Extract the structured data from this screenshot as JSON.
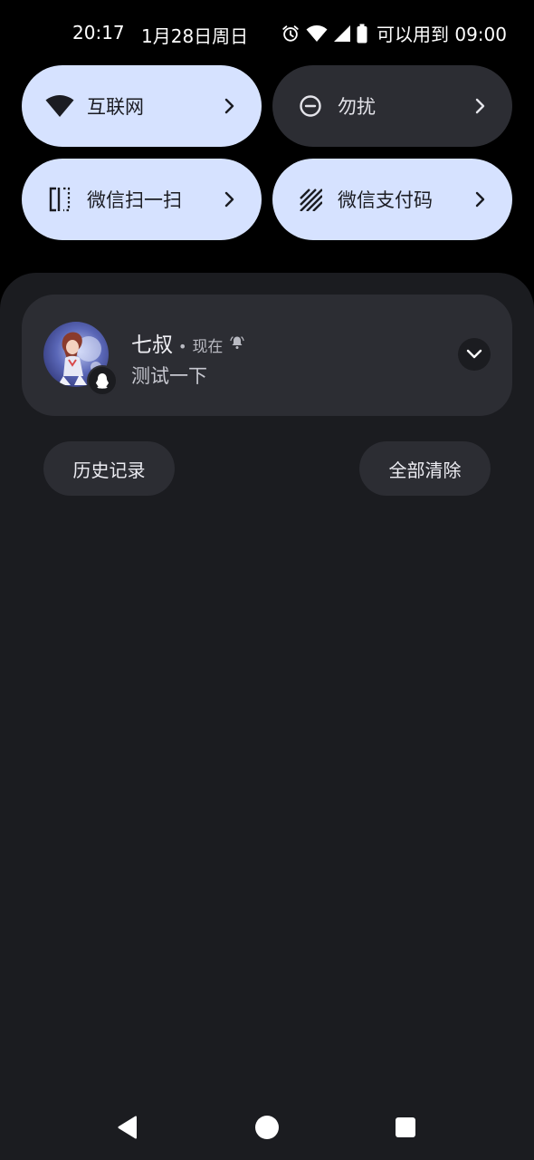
{
  "status_bar": {
    "time": "20:17",
    "date": "1月28日周日",
    "alarm_text": "可以用到 09:00",
    "icons": [
      "alarm-icon",
      "wifi-icon",
      "signal-icon",
      "battery-icon"
    ]
  },
  "quick_tiles": [
    {
      "label": "互联网",
      "icon": "wifi-icon",
      "state": "on"
    },
    {
      "label": "勿扰",
      "icon": "do-not-disturb-icon",
      "state": "off"
    },
    {
      "label": "微信扫一扫",
      "icon": "scan-icon",
      "state": "on"
    },
    {
      "label": "微信支付码",
      "icon": "payment-code-icon",
      "state": "on"
    }
  ],
  "notification": {
    "sender": "七叔",
    "separator": "•",
    "time": "现在",
    "message": "测试一下",
    "app_icon": "qq-icon"
  },
  "actions": {
    "history": "历史记录",
    "clear_all": "全部清除"
  },
  "nav": {
    "icons": [
      "back-icon",
      "home-icon",
      "recents-icon"
    ]
  },
  "colors": {
    "tile_on": "#d6e2ff",
    "tile_off": "#2c2d33",
    "shade_bg": "#1b1c20",
    "card_bg": "#2c2d33"
  }
}
